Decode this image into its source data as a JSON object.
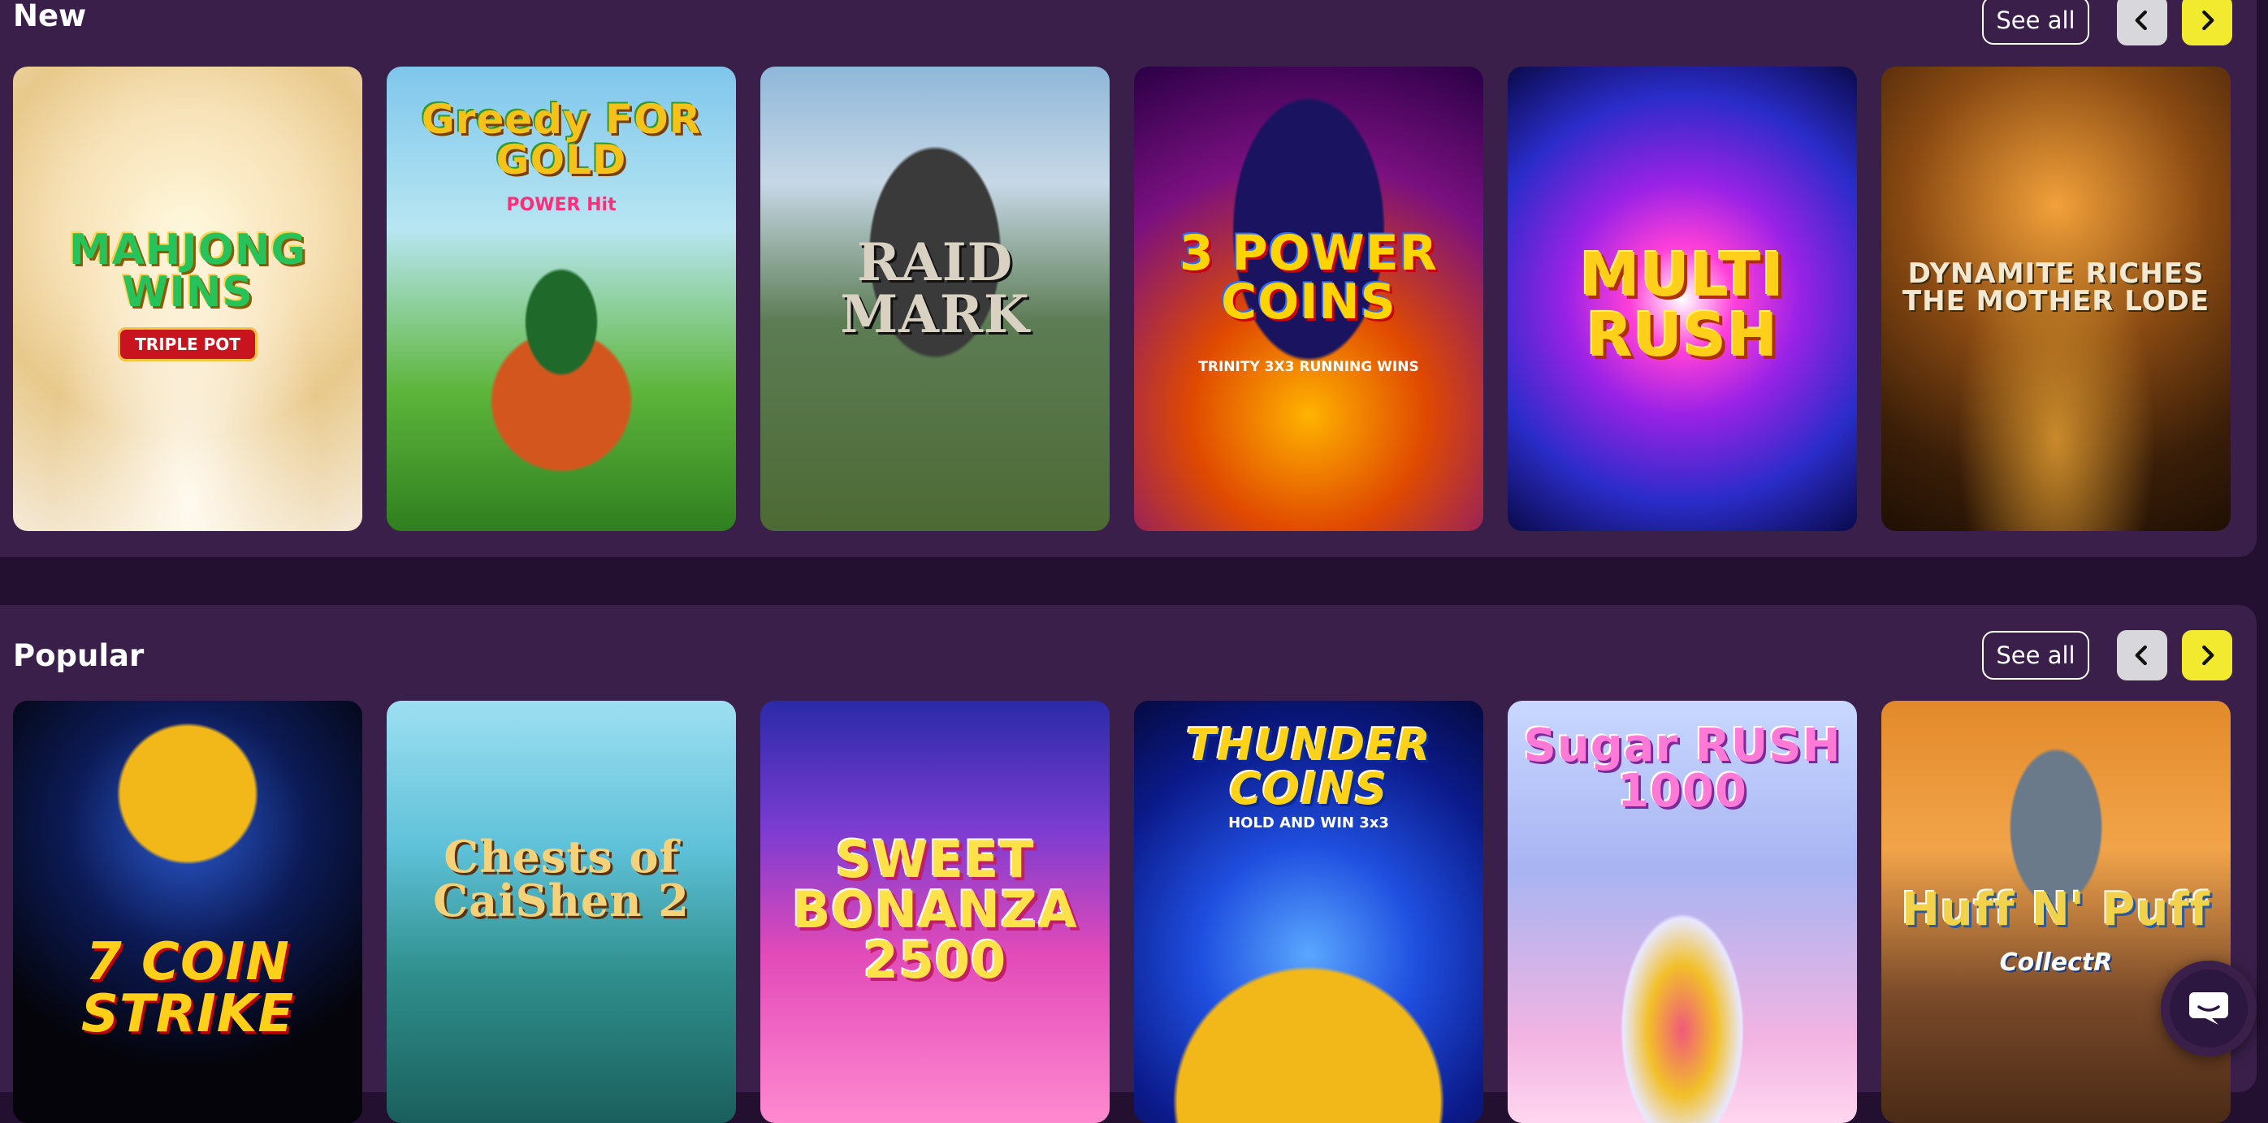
{
  "sections": {
    "new": {
      "title": "New",
      "see_all_label": "See all",
      "cards": [
        {
          "logo": "MAHJONG WINS",
          "sub": "TRIPLE POT"
        },
        {
          "logo": "Greedy FOR GOLD",
          "sub": "POWER Hit"
        },
        {
          "logo": "RAID MARK",
          "sub": ""
        },
        {
          "logo": "3 POWER COINS",
          "sub": "TRINITY 3X3 RUNNING WINS"
        },
        {
          "logo": "MULTI RUSH",
          "sub": ""
        },
        {
          "logo": "DYNAMITE RICHES THE MOTHER LODE",
          "sub": ""
        }
      ]
    },
    "popular": {
      "title": "Popular",
      "see_all_label": "See all",
      "cards": [
        {
          "logo": "7 COIN STRIKE",
          "sub": ""
        },
        {
          "logo": "Chests of CaiShen 2",
          "sub": ""
        },
        {
          "logo": "SWEET BONANZA 2500",
          "sub": ""
        },
        {
          "logo": "THUNDER COINS",
          "sub": "HOLD AND WIN 3x3"
        },
        {
          "logo": "Sugar RUSH 1000",
          "sub": ""
        },
        {
          "logo": "Huff N' Puff",
          "sub": "CollectR"
        }
      ]
    }
  },
  "icons": {
    "prev": "chevron-left-icon",
    "next": "chevron-right-icon",
    "chat": "chat-bubble-icon"
  },
  "colors": {
    "background": "#230f30",
    "panel": "#3a1f4a",
    "accent_yellow": "#f2ea2f",
    "nav_gray": "#d8d8dc"
  }
}
